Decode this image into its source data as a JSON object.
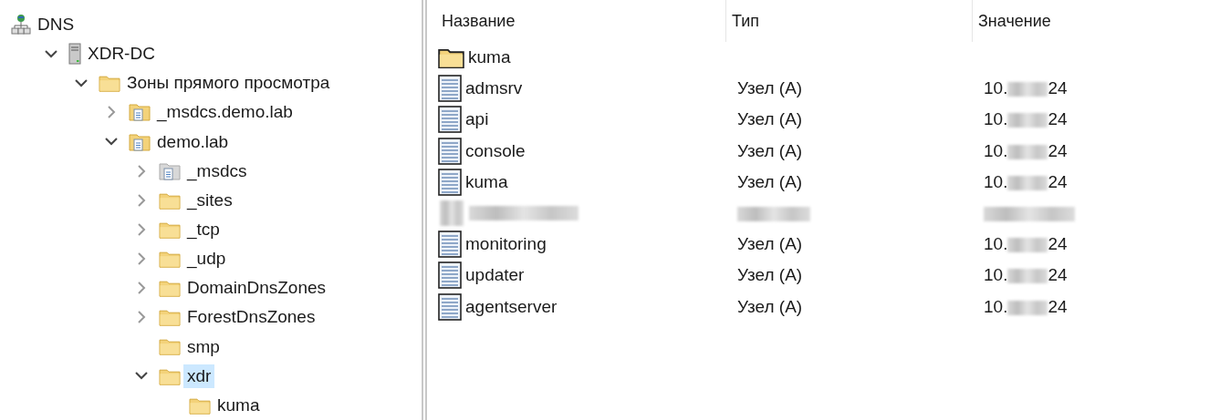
{
  "tree": [
    {
      "label": "DNS",
      "kind": "dns",
      "selected": false,
      "children": [
        {
          "label": "XDR-DC",
          "kind": "server",
          "selected": false,
          "expanded": true,
          "children": [
            {
              "label": "Зоны прямого просмотра",
              "kind": "folder",
              "selected": false,
              "expanded": true,
              "children": [
                {
                  "label": "_msdcs.demo.lab",
                  "kind": "zone",
                  "selected": false,
                  "expanded": false
                },
                {
                  "label": "demo.lab",
                  "kind": "zone",
                  "selected": false,
                  "expanded": true,
                  "children": [
                    {
                      "label": "_msdcs",
                      "kind": "zone-grey",
                      "selected": false,
                      "expanded": false
                    },
                    {
                      "label": "_sites",
                      "kind": "folder",
                      "selected": false,
                      "expanded": false
                    },
                    {
                      "label": "_tcp",
                      "kind": "folder",
                      "selected": false,
                      "expanded": false
                    },
                    {
                      "label": "_udp",
                      "kind": "folder",
                      "selected": false,
                      "expanded": false
                    },
                    {
                      "label": "DomainDnsZones",
                      "kind": "folder",
                      "selected": false,
                      "expanded": false
                    },
                    {
                      "label": "ForestDnsZones",
                      "kind": "folder",
                      "selected": false,
                      "expanded": false
                    },
                    {
                      "label": "smp",
                      "kind": "folder",
                      "selected": false
                    },
                    {
                      "label": "xdr",
                      "kind": "folder",
                      "selected": true,
                      "expanded": true,
                      "children": [
                        {
                          "label": "kuma",
                          "kind": "folder",
                          "selected": false
                        }
                      ]
                    }
                  ]
                }
              ]
            }
          ]
        }
      ]
    }
  ],
  "list": {
    "columns": [
      "Название",
      "Тип",
      "Значение"
    ],
    "rows": [
      {
        "kind": "folder",
        "name": "kuma"
      },
      {
        "kind": "record",
        "name": "admsrv",
        "type": "Узел (A)",
        "value_start": "10.",
        "value_end": "24"
      },
      {
        "kind": "record",
        "name": "api",
        "type": "Узел (A)",
        "value_start": "10.",
        "value_end": "24"
      },
      {
        "kind": "record",
        "name": "console",
        "type": "Узел (A)",
        "value_start": "10.",
        "value_end": "24"
      },
      {
        "kind": "record",
        "name": "kuma",
        "type": "Узел (A)",
        "value_start": "10.",
        "value_end": "24"
      },
      {
        "kind": "redacted"
      },
      {
        "kind": "record",
        "name": "monitoring",
        "type": "Узел (A)",
        "value_start": "10.",
        "value_end": "24"
      },
      {
        "kind": "record",
        "name": "updater",
        "type": "Узел (A)",
        "value_start": "10.",
        "value_end": "24"
      },
      {
        "kind": "record",
        "name": "agentserver",
        "type": "Узел (A)",
        "value_start": "10.",
        "value_end": "24"
      }
    ]
  }
}
